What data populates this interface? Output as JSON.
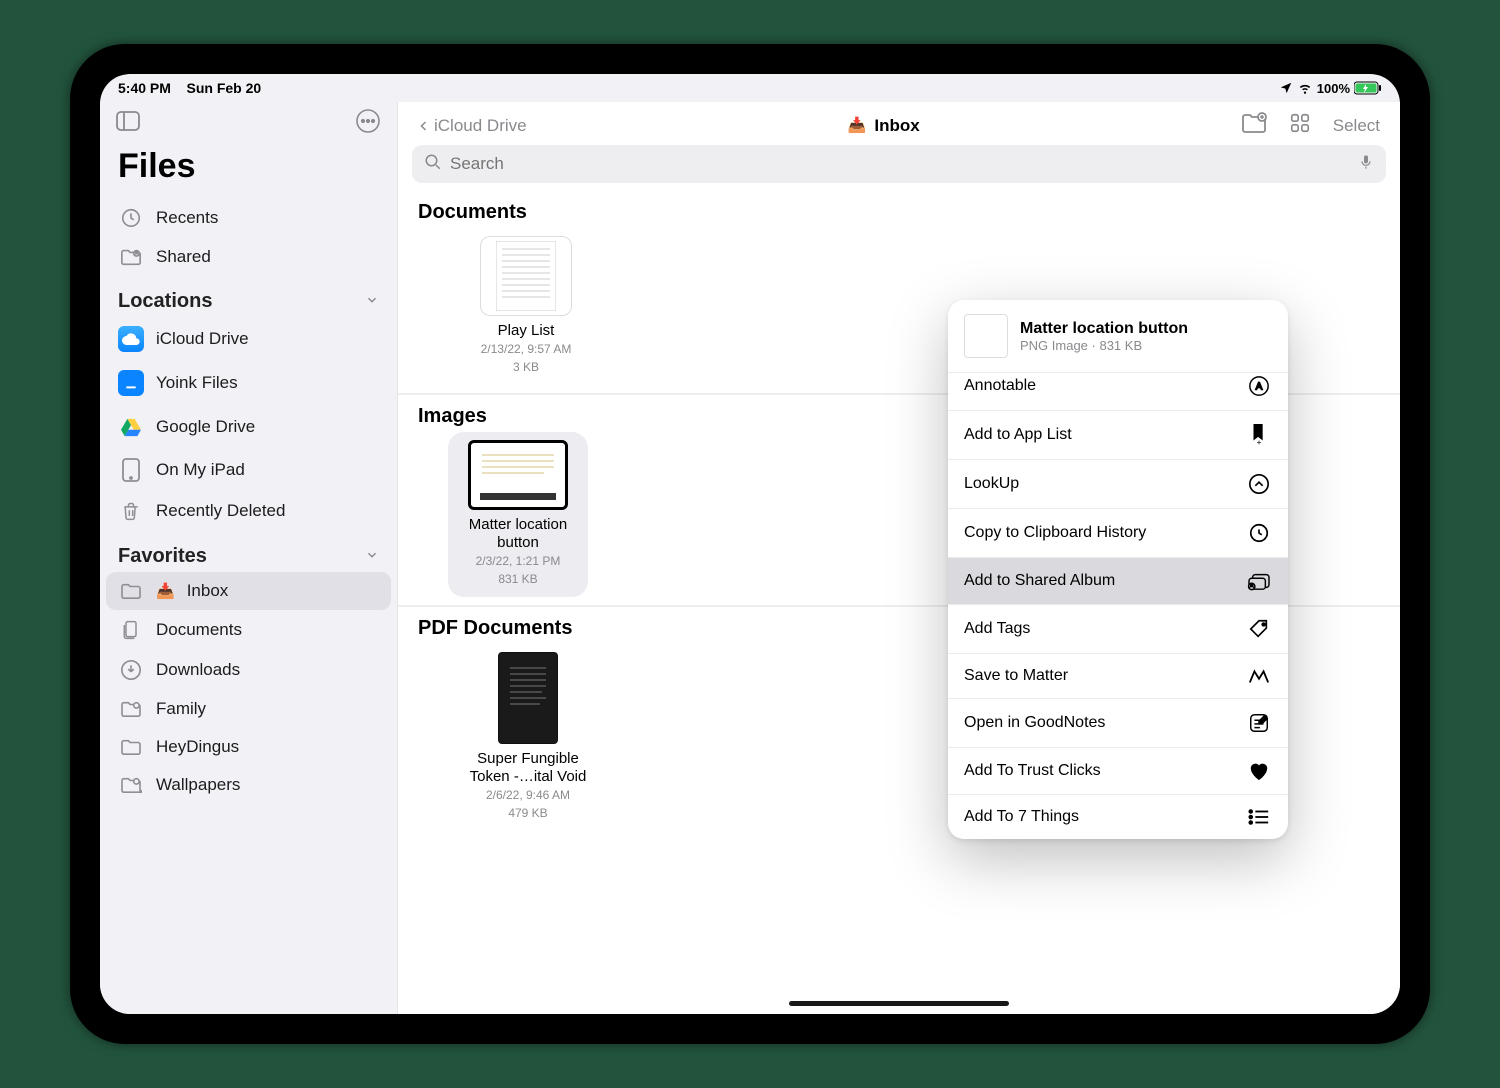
{
  "status": {
    "time": "5:40 PM",
    "date": "Sun Feb 20",
    "battery": "100%"
  },
  "sidebar": {
    "title": "Files",
    "top": [
      {
        "label": "Recents"
      },
      {
        "label": "Shared"
      }
    ],
    "locations_heading": "Locations",
    "locations": [
      {
        "label": "iCloud Drive"
      },
      {
        "label": "Yoink Files"
      },
      {
        "label": "Google Drive"
      },
      {
        "label": "On My iPad"
      },
      {
        "label": "Recently Deleted"
      }
    ],
    "favorites_heading": "Favorites",
    "favorites": [
      {
        "label": "Inbox",
        "selected": true
      },
      {
        "label": "Documents"
      },
      {
        "label": "Downloads"
      },
      {
        "label": "Family"
      },
      {
        "label": "HeyDingus"
      },
      {
        "label": "Wallpapers"
      }
    ]
  },
  "header": {
    "back": "iCloud Drive",
    "title": "Inbox",
    "select": "Select",
    "search_placeholder": "Search"
  },
  "sections": {
    "documents": {
      "heading": "Documents",
      "files": [
        {
          "name": "Play List",
          "meta1": "2/13/22, 9:57 AM",
          "meta2": "3 KB"
        }
      ]
    },
    "images": {
      "heading": "Images",
      "files": [
        {
          "name": "Matter location button",
          "meta1": "2/3/22, 1:21 PM",
          "meta2": "831 KB",
          "selected": true
        }
      ]
    },
    "pdfs": {
      "heading": "PDF Documents",
      "files": [
        {
          "name": "Super Fungible Token -…ital Void",
          "meta1": "2/6/22, 9:46 AM",
          "meta2": "479 KB"
        }
      ]
    }
  },
  "context_menu": {
    "title": "Matter location button",
    "subtitle": "PNG Image · 831 KB",
    "items": [
      {
        "label": "Annotable",
        "icon": "annotate-icon"
      },
      {
        "label": "Add to App List",
        "icon": "bookmark-add-icon"
      },
      {
        "label": "LookUp",
        "icon": "chevron-up-circle-icon"
      },
      {
        "label": "Copy to Clipboard History",
        "icon": "history-icon"
      },
      {
        "label": "Add to Shared Album",
        "icon": "shared-album-icon",
        "highlighted": true
      },
      {
        "label": "Add Tags",
        "icon": "tag-icon"
      },
      {
        "label": "Save to Matter",
        "icon": "matter-icon"
      },
      {
        "label": "Open in GoodNotes",
        "icon": "goodnotes-icon"
      },
      {
        "label": "Add To Trust Clicks",
        "icon": "heart-icon"
      },
      {
        "label": "Add To 7 Things",
        "icon": "list-icon"
      }
    ]
  }
}
